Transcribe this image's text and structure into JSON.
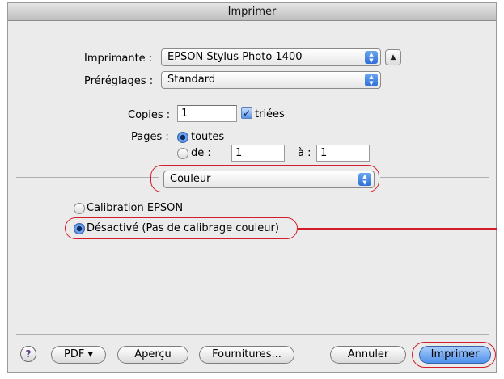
{
  "window": {
    "title": "Imprimer"
  },
  "printer": {
    "label": "Imprimante :",
    "value": "EPSON Stylus Photo 1400"
  },
  "presets": {
    "label": "Préréglages :",
    "value": "Standard"
  },
  "copies": {
    "label": "Copies :",
    "value": "1",
    "collated_label": "triées",
    "collated": true
  },
  "pages": {
    "label": "Pages :",
    "all_label": "toutes",
    "from_label": "de :",
    "from_value": "1",
    "to_label": "à :",
    "to_value": "1",
    "selected": "all"
  },
  "panel": {
    "value": "Couleur"
  },
  "color_options": [
    {
      "label": "Calibration EPSON",
      "selected": false
    },
    {
      "label": "Désactivé (Pas de calibrage couleur)",
      "selected": true
    }
  ],
  "buttons": {
    "help": "?",
    "pdf": "PDF ▾",
    "preview": "Aperçu",
    "supplies": "Fournitures...",
    "cancel": "Annuler",
    "print": "Imprimer"
  },
  "colors": {
    "callout": "#d21d2b",
    "accent": "#3f7fe0"
  }
}
